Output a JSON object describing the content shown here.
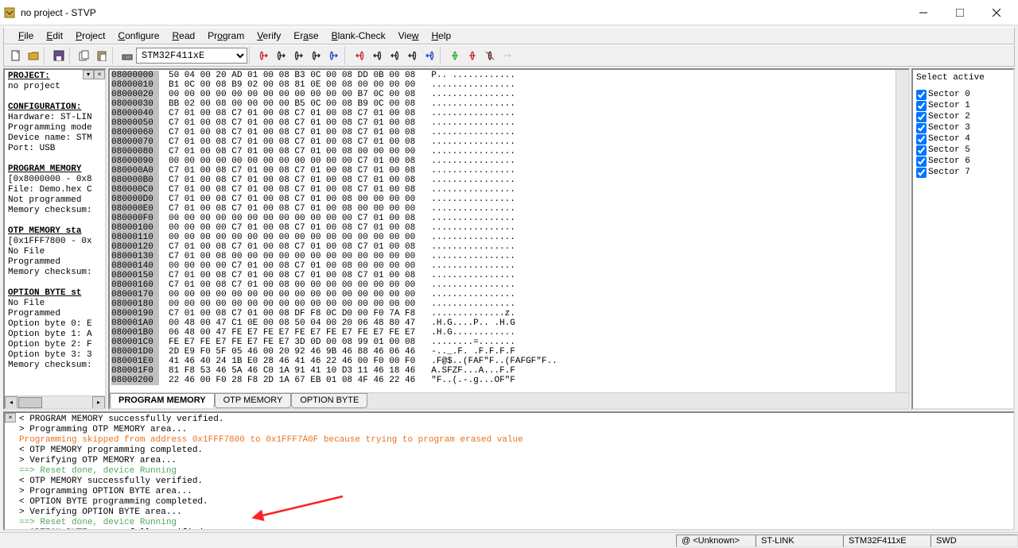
{
  "window": {
    "title": "no project - STVP"
  },
  "menu": [
    "File",
    "Edit",
    "Project",
    "Configure",
    "Read",
    "Program",
    "Verify",
    "Erase",
    "Blank-Check",
    "View",
    "Help"
  ],
  "device": "STM32F411xE",
  "left": {
    "h_project": "PROJECT:",
    "project": "no project",
    "h_config": "CONFIGURATION:",
    "hardware": "Hardware: ST-LIN",
    "progmode": "Programming mode",
    "devname": "Device name: STM",
    "port": "Port: USB",
    "h_progmem": "PROGRAM MEMORY",
    "progmem1": "[0x8000000 - 0x8",
    "progmem2": "File: Demo.hex C",
    "progmem3": "Not programmed",
    "progmem4": "Memory checksum:",
    "h_otp": "OTP MEMORY sta",
    "otp1": "[0x1FFF7800 - 0x",
    "otp2": "No File",
    "otp3": "Programmed",
    "otp4": "Memory checksum:",
    "h_opt": "OPTION BYTE st",
    "opt1": "No File",
    "opt2": "Programmed",
    "opt3": "Option byte 0: E",
    "opt4": "Option byte 1: A",
    "opt5": "Option byte 2: F",
    "opt6": "Option byte 3: 3",
    "opt7": "Memory checksum:"
  },
  "hex": [
    {
      "a": "08000000",
      "b": "50 04 00 20 AD 01 00 08 B3 0C 00 08 DD 0B 00 08",
      "c": "P.. ............"
    },
    {
      "a": "08000010",
      "b": "B1 0C 00 08 B9 02 00 08 81 0E 00 08 00 00 00 00",
      "c": "................"
    },
    {
      "a": "08000020",
      "b": "00 00 00 00 00 00 00 00 00 00 00 00 B7 0C 00 08",
      "c": "................"
    },
    {
      "a": "08000030",
      "b": "BB 02 00 08 00 00 00 00 B5 0C 00 08 B9 0C 00 08",
      "c": "................"
    },
    {
      "a": "08000040",
      "b": "C7 01 00 08 C7 01 00 08 C7 01 00 08 C7 01 00 08",
      "c": "................"
    },
    {
      "a": "08000050",
      "b": "C7 01 00 08 C7 01 00 08 C7 01 00 08 C7 01 00 08",
      "c": "................"
    },
    {
      "a": "08000060",
      "b": "C7 01 00 08 C7 01 00 08 C7 01 00 08 C7 01 00 08",
      "c": "................"
    },
    {
      "a": "08000070",
      "b": "C7 01 00 08 C7 01 00 08 C7 01 00 08 C7 01 00 08",
      "c": "................"
    },
    {
      "a": "08000080",
      "b": "C7 01 00 08 C7 01 00 08 C7 01 00 08 00 00 00 00",
      "c": "................"
    },
    {
      "a": "08000090",
      "b": "00 00 00 00 00 00 00 00 00 00 00 00 C7 01 00 08",
      "c": "................"
    },
    {
      "a": "080000A0",
      "b": "C7 01 00 08 C7 01 00 08 C7 01 00 08 C7 01 00 08",
      "c": "................"
    },
    {
      "a": "080000B0",
      "b": "C7 01 00 08 C7 01 00 08 C7 01 00 08 C7 01 00 08",
      "c": "................"
    },
    {
      "a": "080000C0",
      "b": "C7 01 00 08 C7 01 00 08 C7 01 00 08 C7 01 00 08",
      "c": "................"
    },
    {
      "a": "080000D0",
      "b": "C7 01 00 08 C7 01 00 08 C7 01 00 08 00 00 00 00",
      "c": "................"
    },
    {
      "a": "080000E0",
      "b": "C7 01 00 08 C7 01 00 08 C7 01 00 08 00 00 00 00",
      "c": "................"
    },
    {
      "a": "080000F0",
      "b": "00 00 00 00 00 00 00 00 00 00 00 00 C7 01 00 08",
      "c": "................"
    },
    {
      "a": "08000100",
      "b": "00 00 00 00 C7 01 00 08 C7 01 00 08 C7 01 00 08",
      "c": "................"
    },
    {
      "a": "08000110",
      "b": "00 00 00 00 00 00 00 00 00 00 00 00 00 00 00 00",
      "c": "................"
    },
    {
      "a": "08000120",
      "b": "C7 01 00 08 C7 01 00 08 C7 01 00 08 C7 01 00 08",
      "c": "................"
    },
    {
      "a": "08000130",
      "b": "C7 01 00 08 00 00 00 00 00 00 00 00 00 00 00 00",
      "c": "................"
    },
    {
      "a": "08000140",
      "b": "00 00 00 00 C7 01 00 08 C7 01 00 08 00 00 00 00",
      "c": "................"
    },
    {
      "a": "08000150",
      "b": "C7 01 00 08 C7 01 00 08 C7 01 00 08 C7 01 00 08",
      "c": "................"
    },
    {
      "a": "08000160",
      "b": "C7 01 00 08 C7 01 00 08 00 00 00 00 00 00 00 00",
      "c": "................"
    },
    {
      "a": "08000170",
      "b": "00 00 00 00 00 00 00 00 00 00 00 00 00 00 00 00",
      "c": "................"
    },
    {
      "a": "08000180",
      "b": "00 00 00 00 00 00 00 00 00 00 00 00 00 00 00 00",
      "c": "................"
    },
    {
      "a": "08000190",
      "b": "C7 01 00 08 C7 01 00 08 DF F8 0C D0 00 F0 7A F8",
      "c": "..............z."
    },
    {
      "a": "080001A0",
      "b": "00 48 00 47 C1 0E 00 08 50 04 00 20 06 48 80 47",
      "c": ".H.G....P.. .H.G"
    },
    {
      "a": "080001B0",
      "b": "06 48 00 47 FE E7 FE E7 FE E7 FE E7 FE E7 FE E7",
      "c": ".H.G............"
    },
    {
      "a": "080001C0",
      "b": "FE E7 FE E7 FE E7 FE E7 3D 0D 00 08 99 01 00 08",
      "c": "........=......."
    },
    {
      "a": "080001D0",
      "b": "2D E9 F0 5F 05 46 00 20 92 46 9B 46 88 46 06 46",
      "c": "-.._.F. .F.F.F.F"
    },
    {
      "a": "080001E0",
      "b": "41 46 40 24 1B E0 28 46 41 46 22 46 00 F0 00 F0",
      "c": ".F@$..(FAF\"F..(FAFGF\"F.."
    },
    {
      "a": "080001F0",
      "b": "81 F8 53 46 5A 46 C0 1A 91 41 10 D3 11 46 18 46",
      "c": "A.SFZF...A...F.F"
    },
    {
      "a": "08000200",
      "b": "22 46 00 F0 28 F8 2D 1A 67 EB 01 08 4F 46 22 46",
      "c": "\"F..(.-.g...OF\"F"
    }
  ],
  "tabs": [
    "PROGRAM MEMORY",
    "OTP MEMORY",
    "OPTION BYTE"
  ],
  "right": {
    "title": "Select active",
    "sectors": [
      "Sector 0",
      "Sector 1",
      "Sector 2",
      "Sector 3",
      "Sector 4",
      "Sector 5",
      "Sector 6",
      "Sector 7"
    ]
  },
  "log": [
    {
      "t": "< PROGRAM MEMORY successfully verified.",
      "c": ""
    },
    {
      "t": "> Programming  OTP MEMORY area...",
      "c": ""
    },
    {
      "t": "Programming skipped from address 0x1FFF7800 to 0x1FFF7A0F because trying to program erased value",
      "c": "log-orange"
    },
    {
      "t": "< OTP MEMORY programming completed.",
      "c": ""
    },
    {
      "t": "> Verifying OTP MEMORY area...",
      "c": ""
    },
    {
      "t": "==> Reset done, device Running",
      "c": "log-green"
    },
    {
      "t": "< OTP MEMORY successfully verified.",
      "c": ""
    },
    {
      "t": "> Programming  OPTION BYTE area...",
      "c": ""
    },
    {
      "t": "< OPTION BYTE programming completed.",
      "c": ""
    },
    {
      "t": "> Verifying OPTION BYTE area...",
      "c": ""
    },
    {
      "t": "==> Reset done, device Running",
      "c": "log-green"
    },
    {
      "t": "< OPTION BYTE successfully verified.",
      "c": ""
    }
  ],
  "status": {
    "unknown": "@ <Unknown>",
    "link": "ST-LINK",
    "device": "STM32F411xE",
    "protocol": "SWD"
  }
}
